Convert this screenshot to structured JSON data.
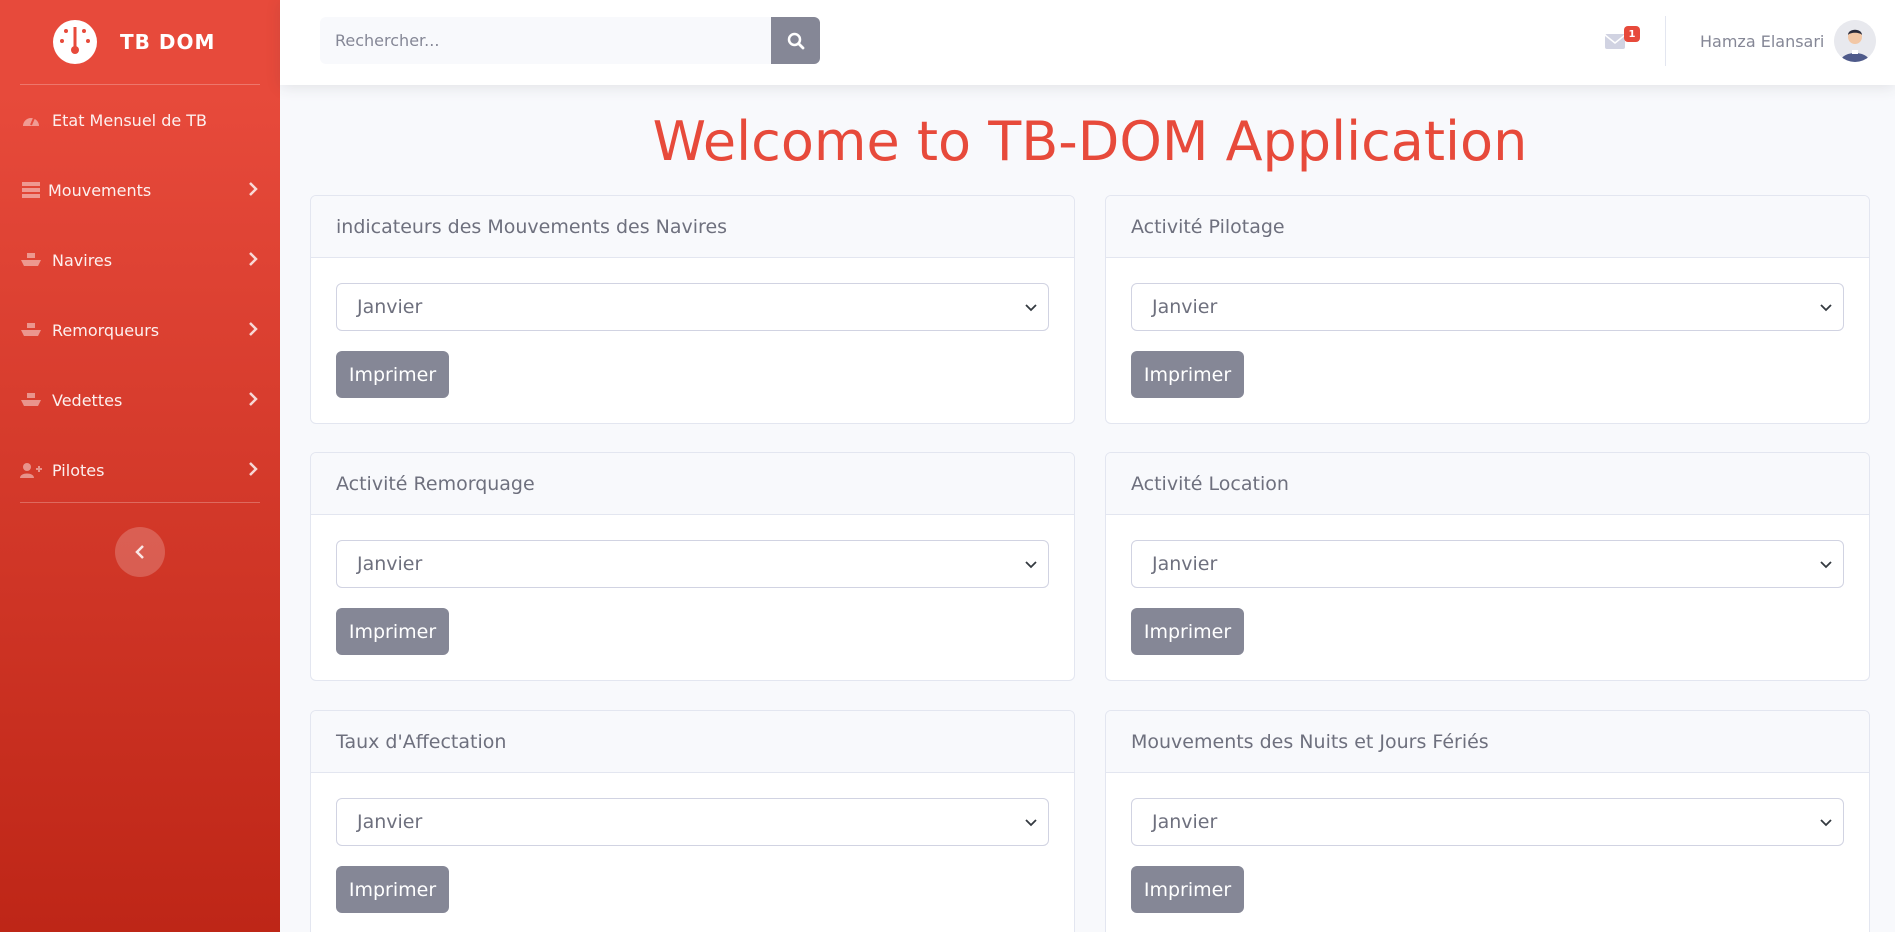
{
  "brand": {
    "name": "TB DOM"
  },
  "sidebar": {
    "items": [
      {
        "label": "Etat Mensuel de TB",
        "icon": "tachometer-icon",
        "has_chevron": false
      },
      {
        "label": "Mouvements",
        "icon": "table-icon",
        "has_chevron": true
      },
      {
        "label": "Navires",
        "icon": "ship-icon",
        "has_chevron": true
      },
      {
        "label": "Remorqueurs",
        "icon": "ship-icon",
        "has_chevron": true
      },
      {
        "label": "Vedettes",
        "icon": "ship-icon",
        "has_chevron": true
      },
      {
        "label": "Pilotes",
        "icon": "user-plus-icon",
        "has_chevron": true
      }
    ]
  },
  "topbar": {
    "search_placeholder": "Rechercher...",
    "messages_count": "1",
    "user_name": "Hamza Elansari"
  },
  "main": {
    "title": "Welcome to TB-DOM Application",
    "cards": [
      {
        "title": "indicateurs des Mouvements des Navires",
        "selected_month": "Janvier",
        "button": "Imprimer"
      },
      {
        "title": "Activité Pilotage",
        "selected_month": "Janvier",
        "button": "Imprimer"
      },
      {
        "title": "Activité Remorquage",
        "selected_month": "Janvier",
        "button": "Imprimer"
      },
      {
        "title": "Activité Location",
        "selected_month": "Janvier",
        "button": "Imprimer"
      },
      {
        "title": "Taux d'Affectation",
        "selected_month": "Janvier",
        "button": "Imprimer"
      },
      {
        "title": "Mouvements des Nuits et Jours Fériés",
        "selected_month": "Janvier",
        "button": "Imprimer"
      }
    ]
  },
  "colors": {
    "primary": "#e74a3b",
    "secondary": "#858796",
    "background": "#f8f9fc"
  }
}
